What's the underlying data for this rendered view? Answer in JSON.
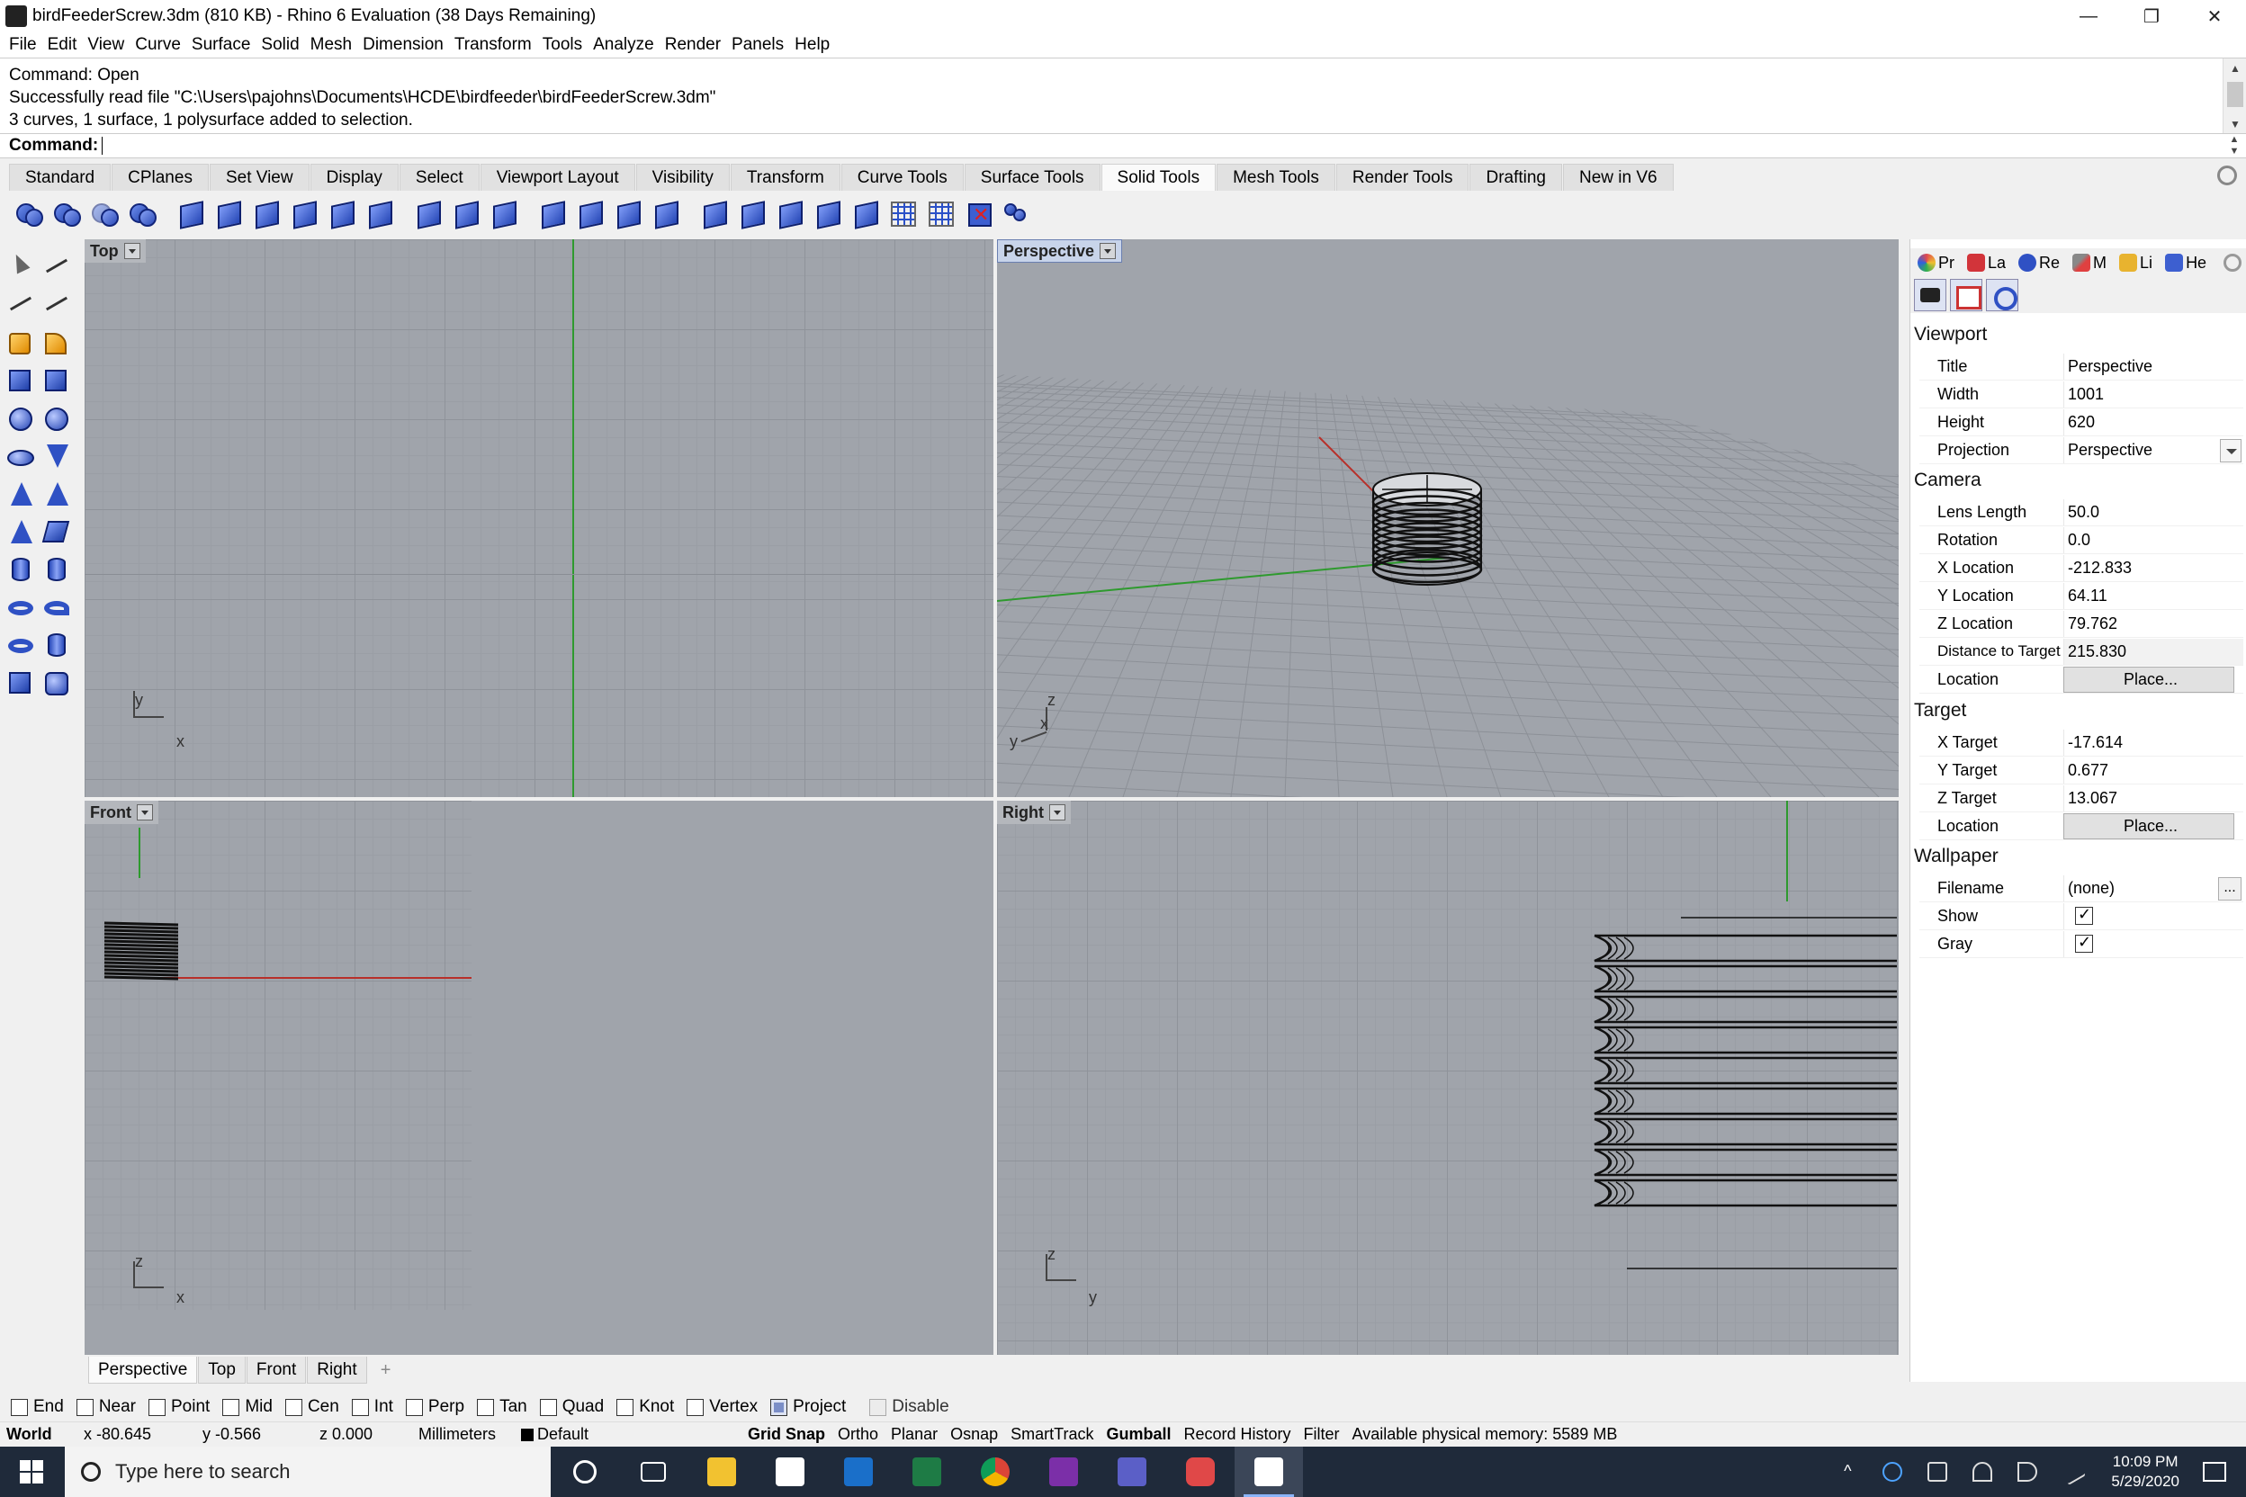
{
  "window": {
    "title": "birdFeederScrew.3dm (810 KB) - Rhino 6 Evaluation (38 Days Remaining)",
    "minimize": "—",
    "maximize": "❐",
    "close": "✕"
  },
  "menu": [
    "File",
    "Edit",
    "View",
    "Curve",
    "Surface",
    "Solid",
    "Mesh",
    "Dimension",
    "Transform",
    "Tools",
    "Analyze",
    "Render",
    "Panels",
    "Help"
  ],
  "command_history": [
    "Command: Open",
    "Successfully read file \"C:\\Users\\pajohns\\Documents\\HCDE\\birdfeeder\\birdFeederScrew.3dm\"",
    "3 curves, 1 surface, 1 polysurface added to selection."
  ],
  "command_prompt": {
    "label": "Command:",
    "value": ""
  },
  "toolbar_tabs": [
    "Standard",
    "CPlanes",
    "Set View",
    "Display",
    "Select",
    "Viewport Layout",
    "Visibility",
    "Transform",
    "Curve Tools",
    "Surface Tools",
    "Solid Tools",
    "Mesh Tools",
    "Render Tools",
    "Drafting",
    "New in V6"
  ],
  "active_toolbar_tab": "Solid Tools",
  "viewports": {
    "top": {
      "label": "Top",
      "axis_x": "x",
      "axis_y": "y"
    },
    "perspective": {
      "label": "Perspective",
      "axis_x": "x",
      "axis_y": "y",
      "axis_z": "z"
    },
    "front": {
      "label": "Front",
      "axis_x": "x",
      "axis_z": "z"
    },
    "right": {
      "label": "Right",
      "axis_y": "y",
      "axis_z": "z"
    }
  },
  "properties_panel": {
    "tabs": [
      {
        "label": "Pr",
        "icon": "properties-icon",
        "color": "#e0484f"
      },
      {
        "label": "La",
        "icon": "layers-icon",
        "color": "#d2343a"
      },
      {
        "label": "Re",
        "icon": "render-icon",
        "color": "#2f51c4"
      },
      {
        "label": "M",
        "icon": "material-icon",
        "color": "#888888"
      },
      {
        "label": "Li",
        "icon": "libraries-icon",
        "color": "#e8b32f"
      },
      {
        "label": "He",
        "icon": "help-icon",
        "color": "#3d5fd0"
      }
    ],
    "viewport_section": "Viewport",
    "viewport": {
      "title_label": "Title",
      "title_value": "Perspective",
      "width_label": "Width",
      "width_value": "1001",
      "height_label": "Height",
      "height_value": "620",
      "projection_label": "Projection",
      "projection_value": "Perspective"
    },
    "camera_section": "Camera",
    "camera": {
      "lens_label": "Lens Length",
      "lens_value": "50.0",
      "rotation_label": "Rotation",
      "rotation_value": "0.0",
      "xloc_label": "X Location",
      "xloc_value": "-212.833",
      "yloc_label": "Y Location",
      "yloc_value": "64.11",
      "zloc_label": "Z Location",
      "zloc_value": "79.762",
      "dist_label": "Distance to Target",
      "dist_value": "215.830",
      "location_label": "Location",
      "location_button": "Place..."
    },
    "target_section": "Target",
    "target": {
      "x_label": "X Target",
      "x_value": "-17.614",
      "y_label": "Y Target",
      "y_value": "0.677",
      "z_label": "Z Target",
      "z_value": "13.067",
      "location_label": "Location",
      "location_button": "Place..."
    },
    "wallpaper_section": "Wallpaper",
    "wallpaper": {
      "filename_label": "Filename",
      "filename_value": "(none)",
      "browse": "...",
      "show_label": "Show",
      "show_checked": true,
      "gray_label": "Gray",
      "gray_checked": true
    }
  },
  "viewport_tabs": [
    "Perspective",
    "Top",
    "Front",
    "Right"
  ],
  "viewport_tab_add": "+",
  "osnaps": [
    {
      "label": "End",
      "checked": false
    },
    {
      "label": "Near",
      "checked": false
    },
    {
      "label": "Point",
      "checked": false
    },
    {
      "label": "Mid",
      "checked": false
    },
    {
      "label": "Cen",
      "checked": false
    },
    {
      "label": "Int",
      "checked": false
    },
    {
      "label": "Perp",
      "checked": false
    },
    {
      "label": "Tan",
      "checked": false
    },
    {
      "label": "Quad",
      "checked": false
    },
    {
      "label": "Knot",
      "checked": false
    },
    {
      "label": "Vertex",
      "checked": false
    },
    {
      "label": "Project",
      "checked": true
    }
  ],
  "osnap_disable": "Disable",
  "status": {
    "cplane": "World",
    "x": "x -80.645",
    "y": "y -0.566",
    "z": "z 0.000",
    "units": "Millimeters",
    "layer": "Default",
    "grid_snap": "Grid Snap",
    "ortho": "Ortho",
    "planar": "Planar",
    "osnap": "Osnap",
    "smarttrack": "SmartTrack",
    "gumball": "Gumball",
    "record_history": "Record History",
    "filter": "Filter",
    "memory": "Available physical memory: 5589 MB"
  },
  "taskbar": {
    "search_placeholder": "Type here to search",
    "time": "10:09 PM",
    "date": "5/29/2020"
  },
  "colors": {
    "viewport_bg": "#a0a4ab",
    "x_axis": "#b8302a",
    "y_axis": "#2e9a2e",
    "accent": "#2f51c4"
  }
}
